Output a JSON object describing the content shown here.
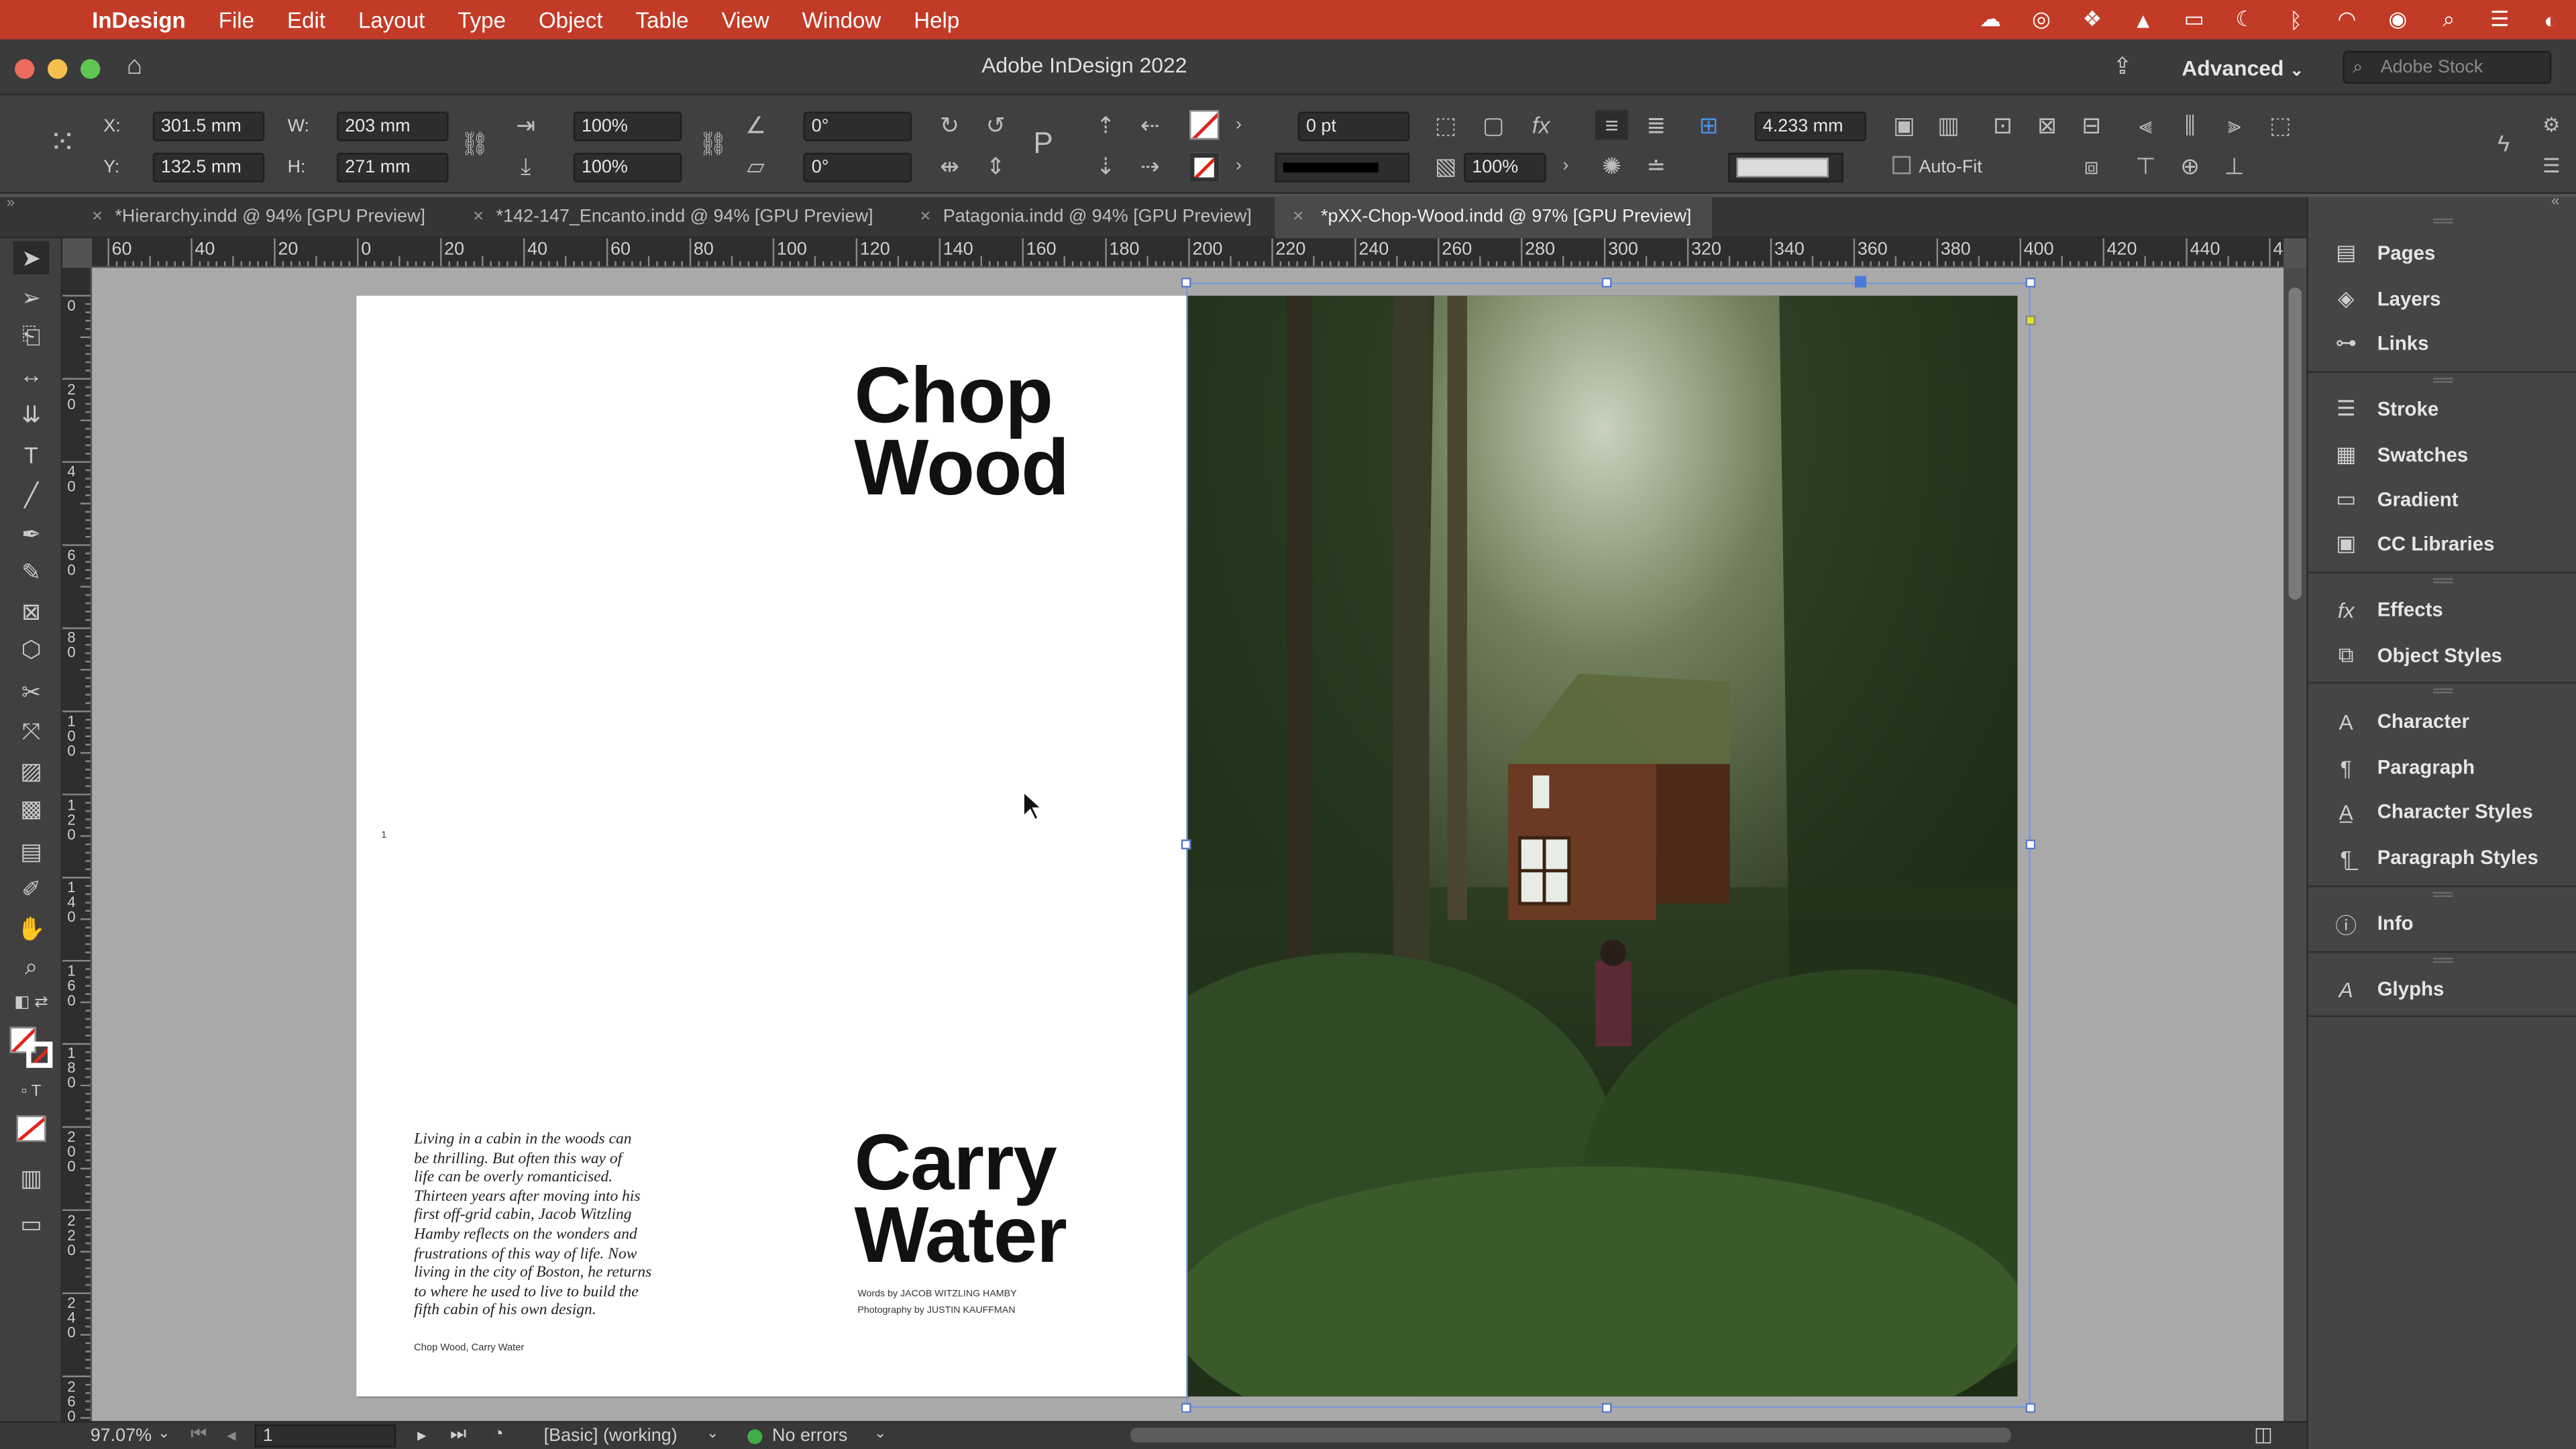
{
  "menubar": {
    "app_name": "InDesign",
    "items": [
      "File",
      "Edit",
      "Layout",
      "Type",
      "Object",
      "Table",
      "View",
      "Window",
      "Help"
    ],
    "status_icons": [
      "creative-cloud-icon",
      "cc-sync-icon",
      "dropbox-icon",
      "adobe-icon",
      "battery-icon",
      "moon-icon",
      "bluetooth-icon",
      "wifi-icon",
      "user-icon",
      "search-icon",
      "control-center-icon",
      "siri-icon"
    ]
  },
  "window": {
    "title": "Adobe InDesign 2022",
    "workspace": "Advanced",
    "stock_placeholder": "Adobe Stock"
  },
  "control_panel": {
    "x_label": "X:",
    "x_value": "301.5 mm",
    "y_label": "Y:",
    "y_value": "132.5 mm",
    "w_label": "W:",
    "w_value": "203 mm",
    "h_label": "H:",
    "h_value": "271 mm",
    "scale_x": "100%",
    "scale_y": "100%",
    "rotation": "0°",
    "shear": "0°",
    "stroke_weight": "0 pt",
    "opacity": "100%",
    "gutter": "4.233 mm",
    "autofit_label": "Auto-Fit"
  },
  "tabs": [
    {
      "label": "*Hierarchy.indd @ 94% [GPU Preview]",
      "active": false
    },
    {
      "label": "*142-147_Encanto.indd @ 94% [GPU Preview]",
      "active": false
    },
    {
      "label": "Patagonia.indd @ 94% [GPU Preview]",
      "active": false
    },
    {
      "label": "*pXX-Chop-Wood.indd @ 97% [GPU Preview]",
      "active": true
    }
  ],
  "ruler_h": [
    "60",
    "40",
    "20",
    "0",
    "20",
    "40",
    "60",
    "80",
    "100",
    "120",
    "140",
    "160",
    "180",
    "200",
    "220",
    "240",
    "260",
    "280",
    "300",
    "320",
    "340",
    "360",
    "380",
    "400",
    "420",
    "440",
    "4"
  ],
  "ruler_v": [
    "0",
    "2\n0",
    "4\n0",
    "6\n0",
    "8\n0",
    "1\n0\n0",
    "1\n2\n0",
    "1\n4\n0",
    "1\n6\n0",
    "1\n8\n0",
    "2\n0\n0",
    "2\n2\n0",
    "2\n4\n0",
    "2\n6\n0"
  ],
  "document": {
    "headline_top": [
      "Chop",
      "Wood"
    ],
    "headline_bottom": [
      "Carry",
      "Water"
    ],
    "page_number": "1",
    "intro_lines": [
      "Living in a cabin in the woods can",
      "be thrilling. But often this way of",
      "life can be overly romanticised.",
      "Thirteen years after moving into his",
      "first off-grid cabin, Jacob Witzling",
      "Hamby reflects on the wonders and",
      "frustrations of this way of life. Now",
      "living in the city of Boston, he returns",
      "to where he used to live to build the",
      "fifth cabin of his own design."
    ],
    "folio": "Chop Wood, Carry Water",
    "credit_words": "Words by JACOB WITZLING HAMBY",
    "credit_photo": "Photography by JUSTIN KAUFFMAN"
  },
  "panels": [
    "Pages",
    "Layers",
    "Links",
    "Stroke",
    "Swatches",
    "Gradient",
    "CC Libraries",
    "Effects",
    "Object Styles",
    "Character",
    "Paragraph",
    "Character Styles",
    "Paragraph Styles",
    "Info",
    "Glyphs"
  ],
  "status": {
    "zoom": "97.07%",
    "page": "1",
    "style": "[Basic] (working)",
    "preflight": "No errors"
  },
  "colors": {
    "menubar": "#c23b27",
    "accent_badge": "#d9261c",
    "preflight_ok": "#3fae49"
  }
}
